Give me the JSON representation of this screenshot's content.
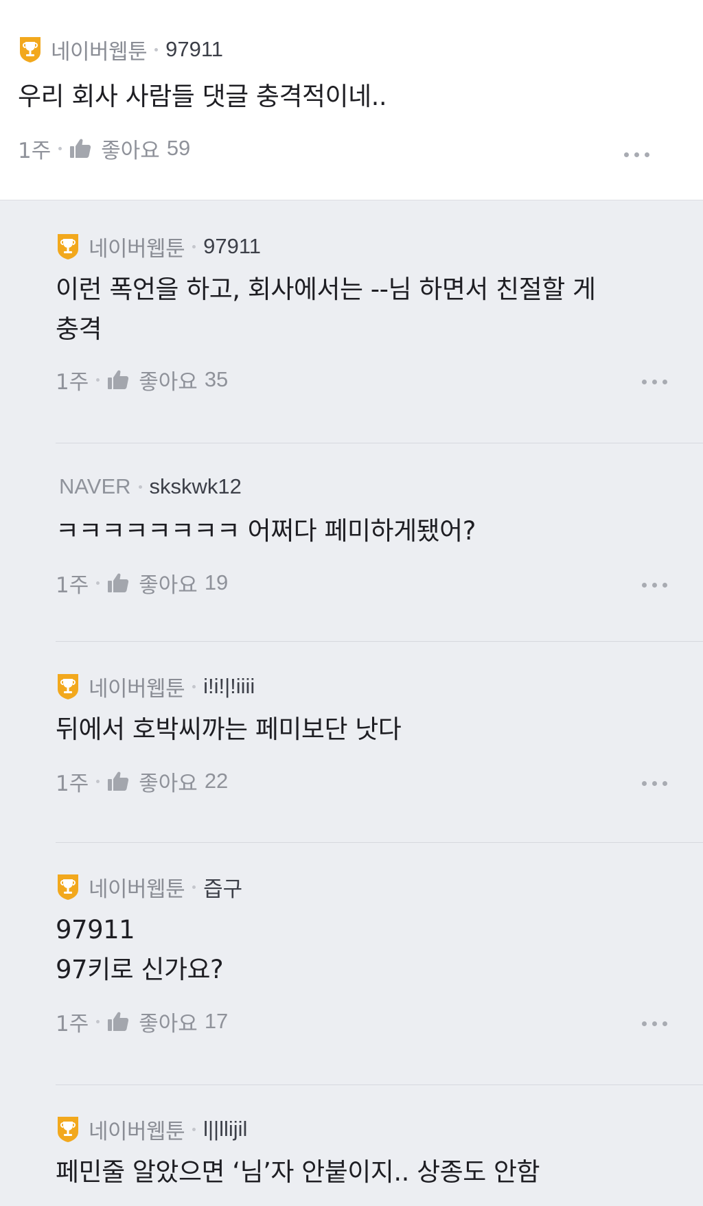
{
  "colors": {
    "badge_orange": "#f2a81d",
    "trophy_white": "#ffffff",
    "page_bg": "#eceef2",
    "post_bg": "#ffffff"
  },
  "icons": {
    "badge": "trophy-icon",
    "like": "thumbs-up-icon",
    "more": "more-icon"
  },
  "post": {
    "source": "네이버웹툰",
    "author": "97911",
    "text": "우리 회사 사람들 댓글 충격적이네..",
    "time": "1주",
    "like_label": "좋아요",
    "like_count": "59"
  },
  "replies": [
    {
      "badge": true,
      "source": "네이버웹툰",
      "author": "97911",
      "text": "이런 폭언을 하고, 회사에서는 --님 하면서 친절할 게\n충격",
      "time": "1주",
      "like_label": "좋아요",
      "like_count": "35"
    },
    {
      "badge": false,
      "source": "NAVER",
      "author": "skskwk12",
      "text": "ㅋㅋㅋㅋㅋㅋㅋㅋ 어쩌다 페미하게됐어?",
      "time": "1주",
      "like_label": "좋아요",
      "like_count": "19"
    },
    {
      "badge": true,
      "source": "네이버웹툰",
      "author": "i!i!|!iiii",
      "text": "뒤에서 호박씨까는 페미보단 낫다",
      "time": "1주",
      "like_label": "좋아요",
      "like_count": "22"
    },
    {
      "badge": true,
      "source": "네이버웹툰",
      "author": "즙구",
      "text": "97911\n97키로 신가요?",
      "time": "1주",
      "like_label": "좋아요",
      "like_count": "17"
    },
    {
      "badge": true,
      "source": "네이버웹툰",
      "author": "l||llijil",
      "text": "페민줄 알았으면 ‘님’자 안붙이지.. 상종도 안함"
    }
  ]
}
